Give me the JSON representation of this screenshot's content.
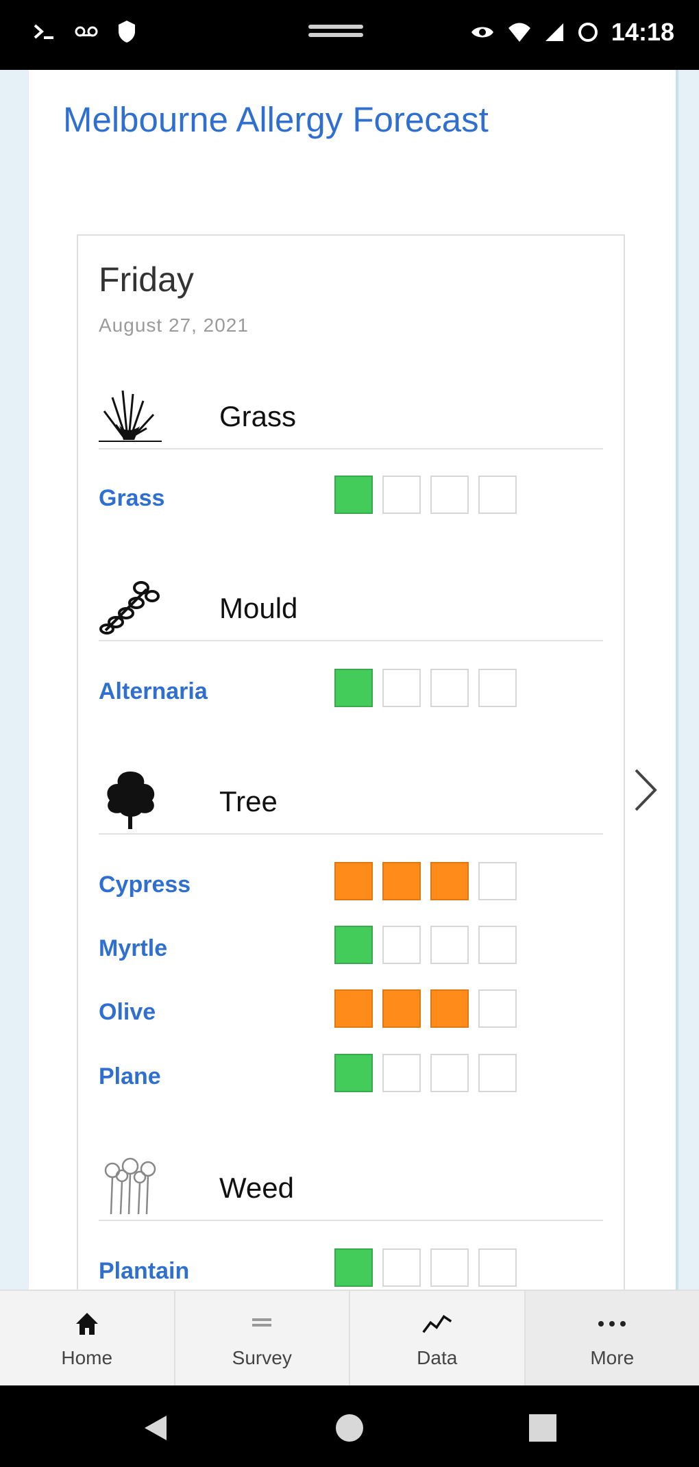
{
  "status_bar": {
    "time": "14:18"
  },
  "app": {
    "title": "Melbourne Allergy Forecast"
  },
  "forecast": {
    "day": "Friday",
    "date": "August 27, 2021",
    "categories": [
      {
        "name": "Grass",
        "icon": "grass-icon",
        "allergens": [
          {
            "name": "Grass",
            "level": 1,
            "color": "#44cc5a"
          }
        ]
      },
      {
        "name": "Mould",
        "icon": "mould-icon",
        "allergens": [
          {
            "name": "Alternaria",
            "level": 1,
            "color": "#44cc5a"
          }
        ]
      },
      {
        "name": "Tree",
        "icon": "tree-icon",
        "allergens": [
          {
            "name": "Cypress",
            "level": 3,
            "color": "#ff8c1a"
          },
          {
            "name": "Myrtle",
            "level": 1,
            "color": "#44cc5a"
          },
          {
            "name": "Olive",
            "level": 3,
            "color": "#ff8c1a"
          },
          {
            "name": "Plane",
            "level": 1,
            "color": "#44cc5a"
          }
        ]
      },
      {
        "name": "Weed",
        "icon": "weed-icon",
        "allergens": [
          {
            "name": "Plantain",
            "level": 1,
            "color": "#44cc5a"
          }
        ]
      }
    ],
    "max_level": 4
  },
  "bottom_nav": {
    "items": [
      {
        "label": "Home",
        "icon": "home-icon"
      },
      {
        "label": "Survey",
        "icon": "list-icon"
      },
      {
        "label": "Data",
        "icon": "chart-line-icon"
      },
      {
        "label": "More",
        "icon": "more-icon"
      }
    ]
  },
  "colors": {
    "accent": "#2f6fd0",
    "low": "#44cc5a",
    "high": "#ff8c1a"
  }
}
